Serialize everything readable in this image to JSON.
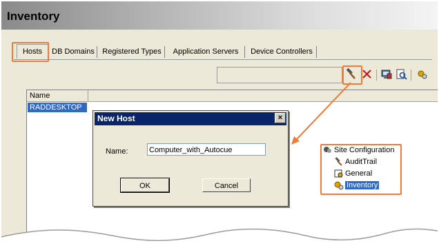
{
  "window": {
    "title": "Inventory"
  },
  "tabs": [
    {
      "label": "Hosts",
      "active": true
    },
    {
      "label": "DB Domains",
      "active": false
    },
    {
      "label": "Registered Types",
      "active": false
    },
    {
      "label": "Application Servers",
      "active": false
    },
    {
      "label": "Device Controllers",
      "active": false
    }
  ],
  "toolbar": {
    "icons": [
      "hammer-icon",
      "delete-x-icon",
      "computer-icon",
      "search-doc-icon",
      "gears-icon"
    ]
  },
  "list": {
    "columns": [
      "Name"
    ],
    "rows": [
      {
        "name": "RADDESKTOP",
        "selected": true
      }
    ]
  },
  "dialog": {
    "title": "New Host",
    "name_label": "Name:",
    "name_value": "Computer_with_Autocue",
    "ok_label": "OK",
    "cancel_label": "Cancel",
    "close_glyph": "×"
  },
  "tree": {
    "root": "Site Configuration",
    "items": [
      {
        "label": "AuditTrail",
        "icon": "hammer-icon",
        "selected": false
      },
      {
        "label": "General",
        "icon": "general-icon",
        "selected": false
      },
      {
        "label": "Inventory",
        "icon": "inventory-icon",
        "selected": true
      }
    ]
  },
  "colors": {
    "highlight": "#f07a38",
    "selection": "#316ac5",
    "dialog_title": "#0a246a"
  }
}
